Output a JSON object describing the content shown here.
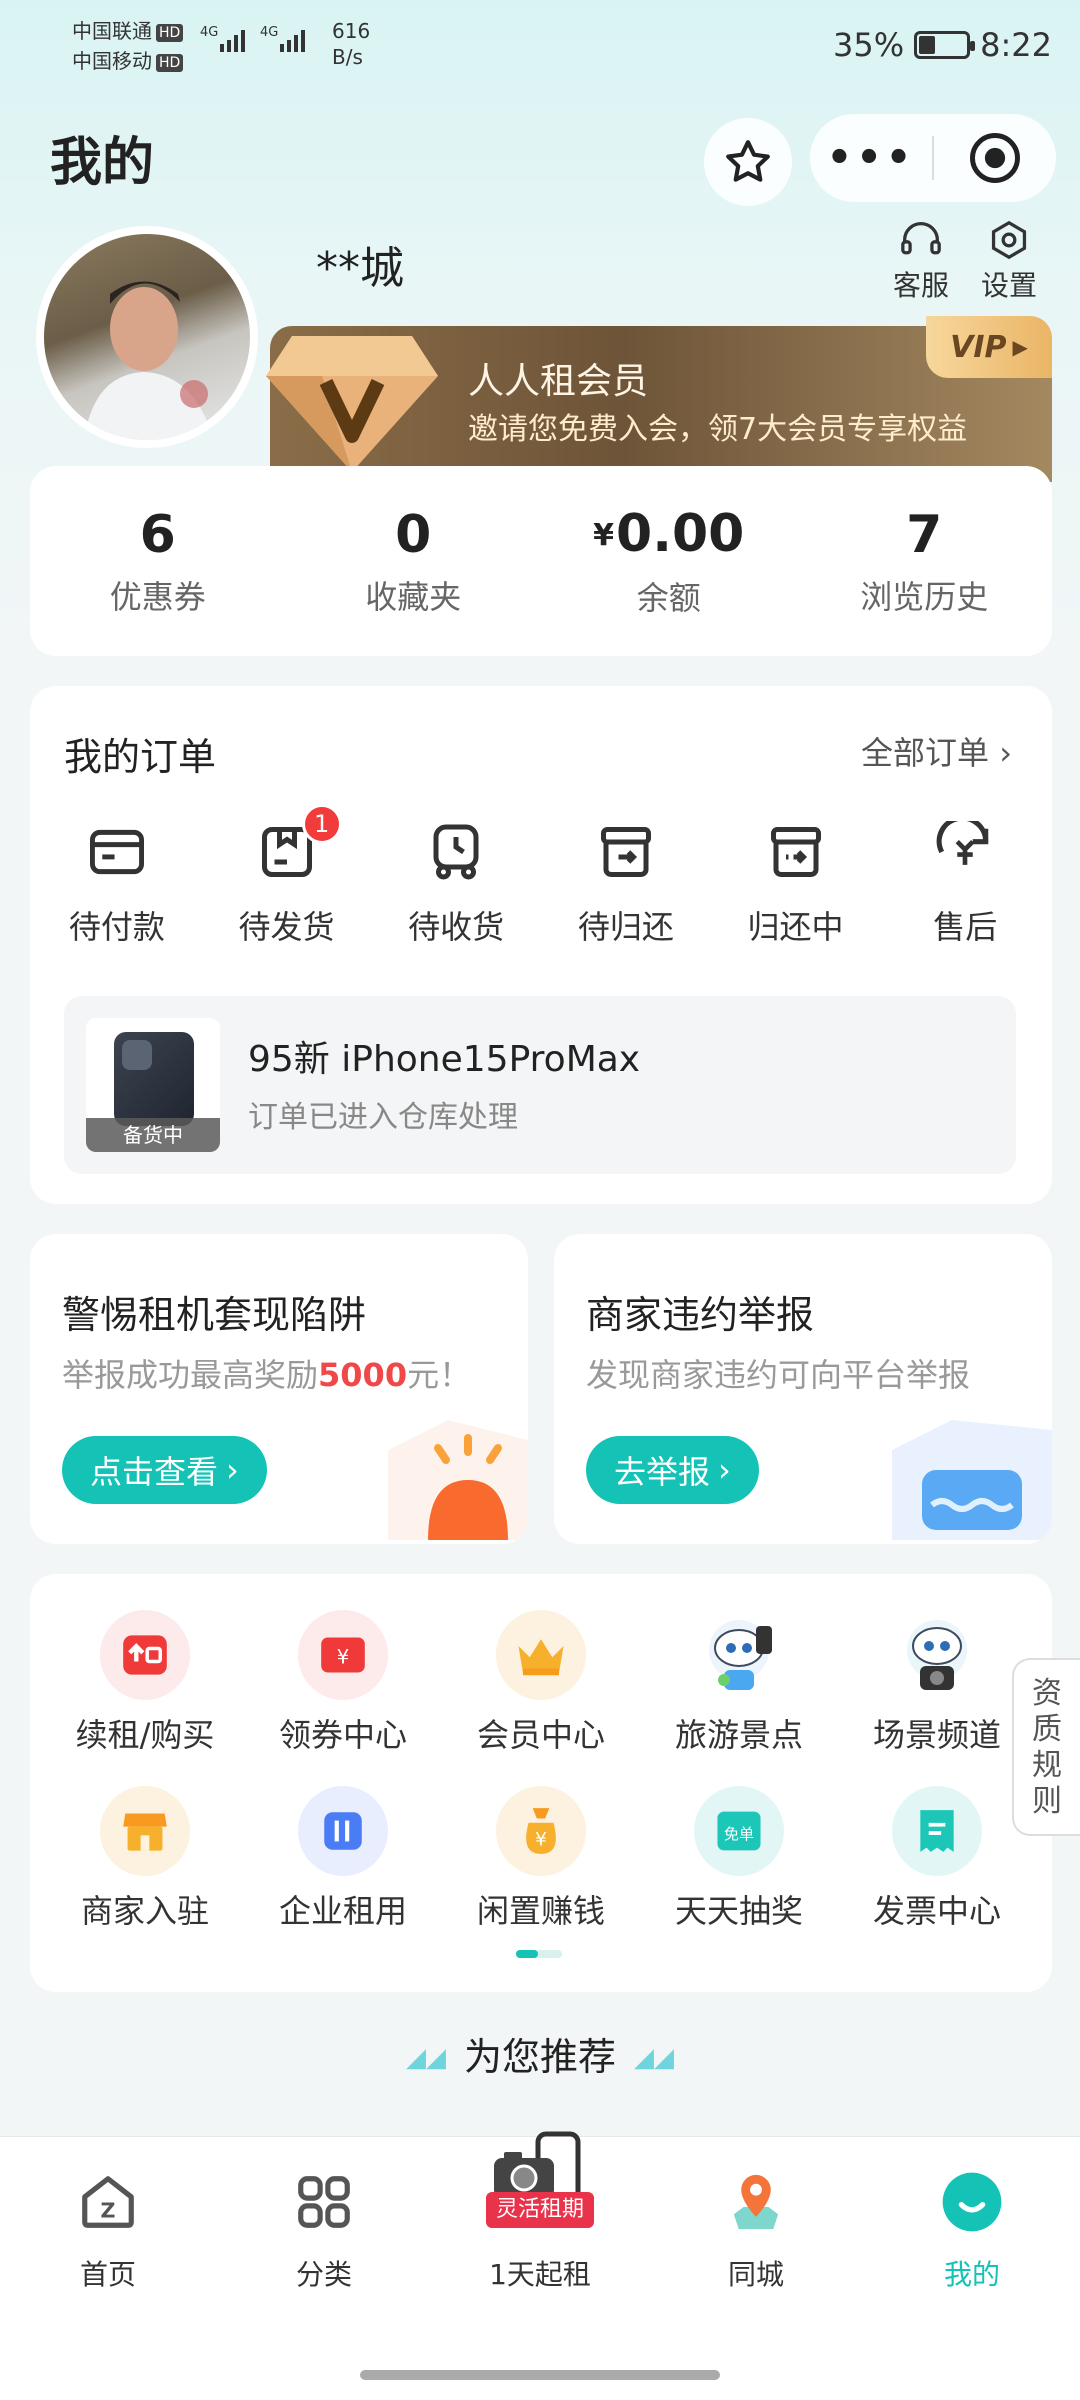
{
  "status_bar": {
    "carrier1": "中国联通",
    "carrier2": "中国移动",
    "hd": "HD",
    "speed_value": "616",
    "speed_unit": "B/s",
    "battery": "35%",
    "battery_level": 0.35,
    "time": "8:22"
  },
  "header": {
    "title": "我的"
  },
  "profile": {
    "username": "**城",
    "service_label": "客服",
    "settings_label": "设置"
  },
  "vip": {
    "title": "人人租会员",
    "subtitle": "邀请您免费入会，领7大会员专享权益",
    "tag": "VIP"
  },
  "stats": [
    {
      "num": "6",
      "label": "优惠券"
    },
    {
      "num": "0",
      "label": "收藏夹"
    },
    {
      "num": "0.00",
      "label": "余额",
      "prefix": "¥"
    },
    {
      "num": "7",
      "label": "浏览历史"
    }
  ],
  "orders": {
    "title": "我的订单",
    "all_label": "全部订单",
    "items": [
      {
        "label": "待付款"
      },
      {
        "label": "待发货",
        "badge": "1"
      },
      {
        "label": "待收货"
      },
      {
        "label": "待归还"
      },
      {
        "label": "归还中"
      },
      {
        "label": "售后"
      }
    ],
    "preview": {
      "tag": "备货中",
      "product": "95新 iPhone15ProMax",
      "status": "订单已进入仓库处理"
    }
  },
  "promos": [
    {
      "title": "警惕租机套现陷阱",
      "sub_pre": "举报成功最高奖励",
      "sub_hl": "5000",
      "sub_post": "元！",
      "button": "点击查看"
    },
    {
      "title": "商家违约举报",
      "sub": "发现商家违约可向平台举报",
      "button": "去举报"
    }
  ],
  "services": [
    {
      "label": "续租/购买",
      "icon": "renew-icon",
      "bg": "#fdeaea"
    },
    {
      "label": "领券中心",
      "icon": "coupon-icon",
      "bg": "#fdeaea"
    },
    {
      "label": "会员中心",
      "icon": "crown-icon",
      "bg": "#fdf1e0"
    },
    {
      "label": "旅游景点",
      "icon": "travel-mascot-icon",
      "bg": "#ffffff"
    },
    {
      "label": "场景频道",
      "icon": "scene-mascot-icon",
      "bg": "#ffffff"
    },
    {
      "label": "商家入驻",
      "icon": "shop-icon",
      "bg": "#fdf1e0"
    },
    {
      "label": "企业租用",
      "icon": "enterprise-icon",
      "bg": "#e8eefd"
    },
    {
      "label": "闲置赚钱",
      "icon": "money-bag-icon",
      "bg": "#fdf1e0"
    },
    {
      "label": "天天抽奖",
      "icon": "lottery-icon",
      "bg": "#e2f7f5"
    },
    {
      "label": "发票中心",
      "icon": "invoice-icon",
      "bg": "#e2f7f5"
    }
  ],
  "qualification_tab": "资质规则",
  "recommend_title": "为您推荐",
  "bottom_nav": [
    {
      "label": "首页",
      "icon": "home-icon"
    },
    {
      "label": "分类",
      "icon": "category-icon"
    },
    {
      "label": "1天起租",
      "icon": "flexible-rent-icon",
      "tag": "灵活租期"
    },
    {
      "label": "同城",
      "icon": "location-icon"
    },
    {
      "label": "我的",
      "icon": "profile-icon",
      "active": true
    }
  ],
  "colors": {
    "accent": "#14c2b6",
    "badge": "#f23b3b",
    "highlight": "#f04848",
    "vip_gold": "#eab566"
  }
}
